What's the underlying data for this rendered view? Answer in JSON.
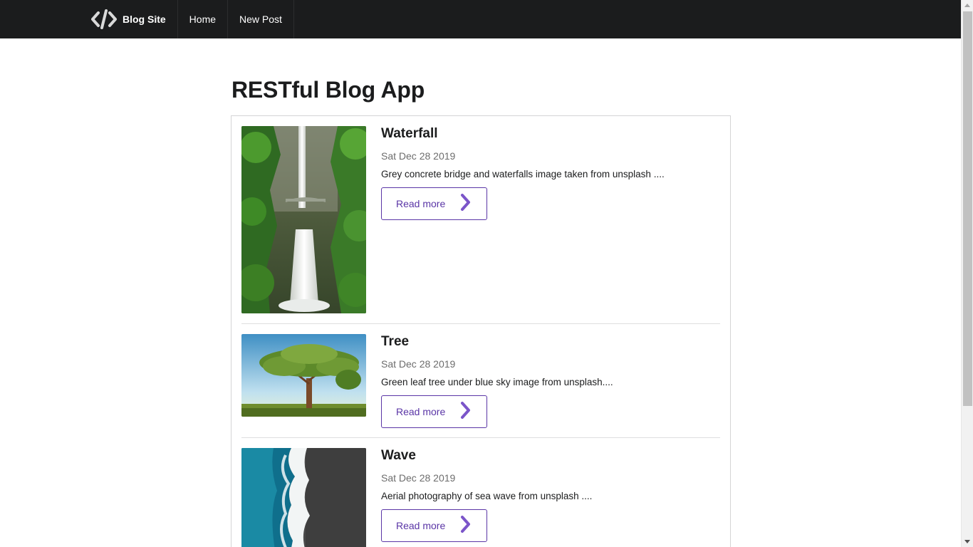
{
  "nav": {
    "brand": "Blog Site",
    "brand_icon": "code-brackets-icon",
    "items": [
      {
        "label": "Home"
      },
      {
        "label": "New Post"
      }
    ]
  },
  "page": {
    "title": "RESTful Blog App"
  },
  "posts": [
    {
      "title": "Waterfall",
      "date": "Sat Dec 28 2019",
      "description": "Grey concrete bridge and waterfalls image taken from unsplash ....",
      "button": "Read more",
      "image": "waterfall-image"
    },
    {
      "title": "Tree",
      "date": "Sat Dec 28 2019",
      "description": "Green leaf tree under blue sky image from unsplash....",
      "button": "Read more",
      "image": "tree-image"
    },
    {
      "title": "Wave",
      "date": "Sat Dec 28 2019",
      "description": "Aerial photography of sea wave from unsplash ....",
      "button": "Read more",
      "image": "wave-image"
    }
  ],
  "colors": {
    "navbar": "#1b1c1d",
    "accent": "#5a35a6",
    "text": "#1b1c1d",
    "muted": "#6d6d6d",
    "border": "#d4d4d5"
  }
}
